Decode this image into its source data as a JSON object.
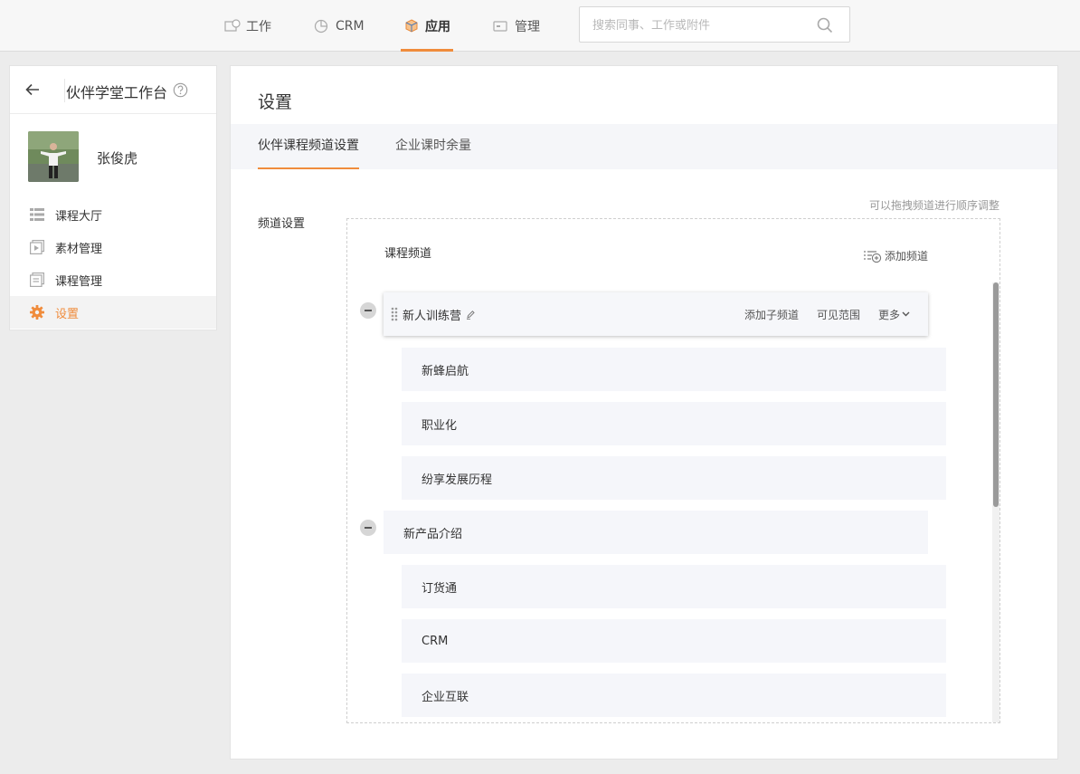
{
  "nav": {
    "items": [
      {
        "label": "工作",
        "icon": "work-icon"
      },
      {
        "label": "CRM",
        "icon": "crm-icon"
      },
      {
        "label": "应用",
        "icon": "app-box-icon"
      },
      {
        "label": "管理",
        "icon": "admin-icon"
      }
    ],
    "active": "应用",
    "search_placeholder": "搜索同事、工作或附件"
  },
  "sidebar": {
    "title": "伙伴学堂工作台",
    "user_name": "张俊虎",
    "items": [
      {
        "label": "课程大厅",
        "icon": "list-icon"
      },
      {
        "label": "素材管理",
        "icon": "media-icon"
      },
      {
        "label": "课程管理",
        "icon": "course-icon"
      },
      {
        "label": "设置",
        "icon": "gear-icon"
      }
    ],
    "active": "设置"
  },
  "main": {
    "title": "设置",
    "tabs": [
      {
        "label": "伙伴课程频道设置"
      },
      {
        "label": "企业课时余量"
      }
    ],
    "active_tab": "伙伴课程频道设置",
    "field_label": "频道设置",
    "hint": "可以拖拽频道进行顺序调整",
    "box_title": "课程频道",
    "add_channel": "添加频道",
    "groups": [
      {
        "name": "新人训练营",
        "actions": [
          "添加子频道",
          "可见范围",
          "更多"
        ],
        "children": [
          "新蜂启航",
          "职业化",
          "纷享发展历程"
        ]
      },
      {
        "name": "新产品介绍",
        "children": [
          "订货通",
          "CRM",
          "企业互联"
        ]
      }
    ]
  },
  "colors": {
    "accent": "#f08c3c",
    "row_bg": "#f5f6fa",
    "tab_bg": "#f5f6f9"
  }
}
